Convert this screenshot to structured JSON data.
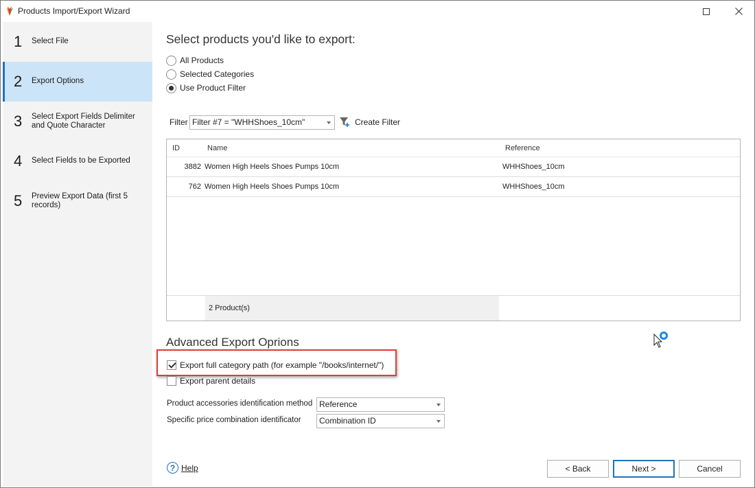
{
  "window": {
    "title": "Products Import/Export Wizard"
  },
  "steps": [
    {
      "num": "1",
      "label": "Select File"
    },
    {
      "num": "2",
      "label": "Export Options"
    },
    {
      "num": "3",
      "label": "Select Export Fields Delimiter and Quote Character"
    },
    {
      "num": "4",
      "label": "Select Fields to be Exported"
    },
    {
      "num": "5",
      "label": "Preview Export Data (first 5 records)"
    }
  ],
  "active_step": "2",
  "main": {
    "heading": "Select products you'd like to export:",
    "radios": [
      {
        "label": "All Products",
        "checked": false
      },
      {
        "label": "Selected Categories",
        "checked": false
      },
      {
        "label": "Use Product Filter",
        "checked": true
      }
    ],
    "filter_label": "Filter",
    "filter_value": "Filter #7 = \"WHHShoes_10cm\"",
    "create_filter_label": "Create Filter"
  },
  "grid": {
    "columns": {
      "id": "ID",
      "name": "Name",
      "reference": "Reference"
    },
    "rows": [
      {
        "id": "3882",
        "name": "Women High Heels Shoes Pumps 10cm",
        "reference": "WHHShoes_10cm"
      },
      {
        "id": "762",
        "name": "Women High Heels Shoes Pumps 10cm",
        "reference": "WHHShoes_10cm"
      }
    ],
    "footer": "2 Product(s)"
  },
  "advanced": {
    "heading": "Advanced Export Oprions",
    "checkboxes": [
      {
        "label": "Export full category path (for example \"/books/internet/\")",
        "checked": true
      },
      {
        "label": "Export parent details",
        "checked": false
      }
    ],
    "accessories_label": "Product accessories identification method",
    "accessories_value": "Reference",
    "price_label": "Specific price combination identificator",
    "price_value": "Combination ID"
  },
  "footer": {
    "help": "Help",
    "back": "< Back",
    "next": "Next >",
    "cancel": "Cancel"
  },
  "colors": {
    "accent": "#1e72bd",
    "active_step_bg": "#cce4f7",
    "sidebar_bg": "#f3f3f3",
    "highlight_box": "#e53935"
  }
}
